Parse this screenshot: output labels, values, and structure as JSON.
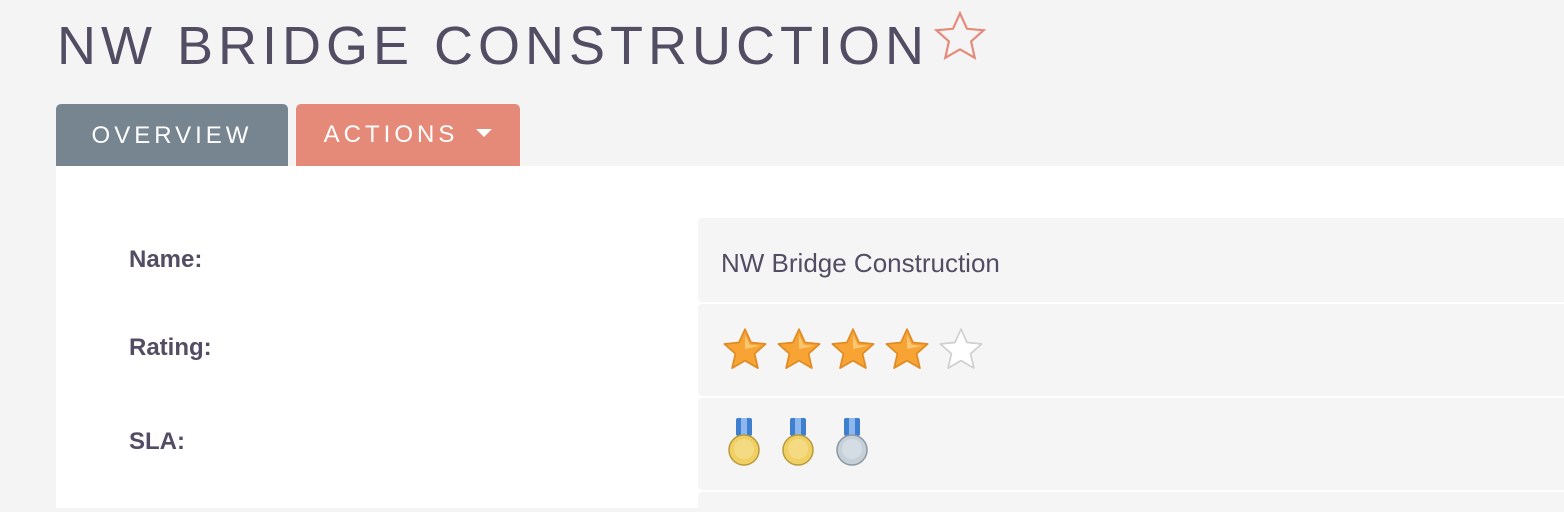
{
  "header": {
    "title": "NW BRIDGE CONSTRUCTION",
    "favorite_icon": "star-outline-icon"
  },
  "tabs": [
    {
      "label": "OVERVIEW",
      "active": true
    },
    {
      "label": "ACTIONS",
      "has_dropdown": true
    }
  ],
  "fields": {
    "name": {
      "label": "Name:",
      "value": "NW Bridge Construction"
    },
    "rating": {
      "label": "Rating:",
      "value": 4,
      "max": 5
    },
    "sla": {
      "label": "SLA:",
      "value": 2,
      "max": 3
    }
  },
  "colors": {
    "title": "#534d64",
    "overview_tab": "#778591",
    "actions_tab": "#e58a79",
    "star_filled": "#f7a435",
    "medal_gold": "#f0cf63",
    "medal_silver": "#c5d0d8"
  }
}
